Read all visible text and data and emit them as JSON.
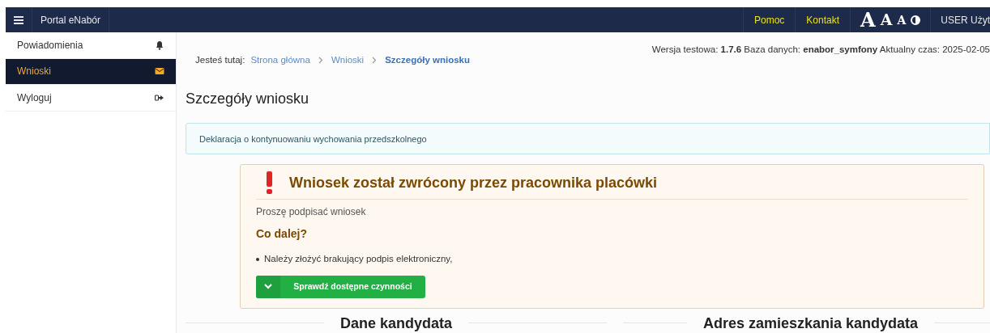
{
  "navbar": {
    "title": "Portal eNabór",
    "links": [
      "Pomoc",
      "Kontakt"
    ],
    "font_sizes": [
      {
        "label": "A",
        "kind": "large"
      },
      {
        "label": "A",
        "kind": "medium"
      },
      {
        "label": "A",
        "kind": "small"
      }
    ],
    "user": "USER Użyt"
  },
  "sidebar": {
    "items": [
      {
        "label": "Powiadomienia",
        "kind": "bell",
        "selected": false
      },
      {
        "label": "Wnioski",
        "kind": "envelope",
        "selected": true
      },
      {
        "label": "Wyloguj",
        "kind": "logout",
        "selected": false
      }
    ]
  },
  "breadcrumb": {
    "prefix": "Jesteś tutaj:",
    "items": [
      {
        "label": "Strona główna",
        "selected": false
      },
      {
        "label": "Wnioski",
        "selected": false
      },
      {
        "label": "Szczegóły wniosku",
        "selected": true
      }
    ]
  },
  "version_info": "Wersja testowa: **1.7.6** Baza danych: **enabor_symfony** Aktualny czas: 2025-02-05",
  "page_title": "Szczegóły wniosku",
  "info_box": "Deklaracja o kontynuowaniu wychowania przedszkolnego",
  "alert": {
    "title": "Wniosek został zwrócony przez pracownika placówki",
    "message": "Proszę podpisać wniosek",
    "next_heading": "Co dalej?",
    "steps": [
      "Należy złożyć brakujący podpis elektroniczny,"
    ],
    "button": "Sprawdź dostępne czynności"
  },
  "sections": [
    "Dane kandydata",
    "Adres zamieszkania kandydata"
  ]
}
